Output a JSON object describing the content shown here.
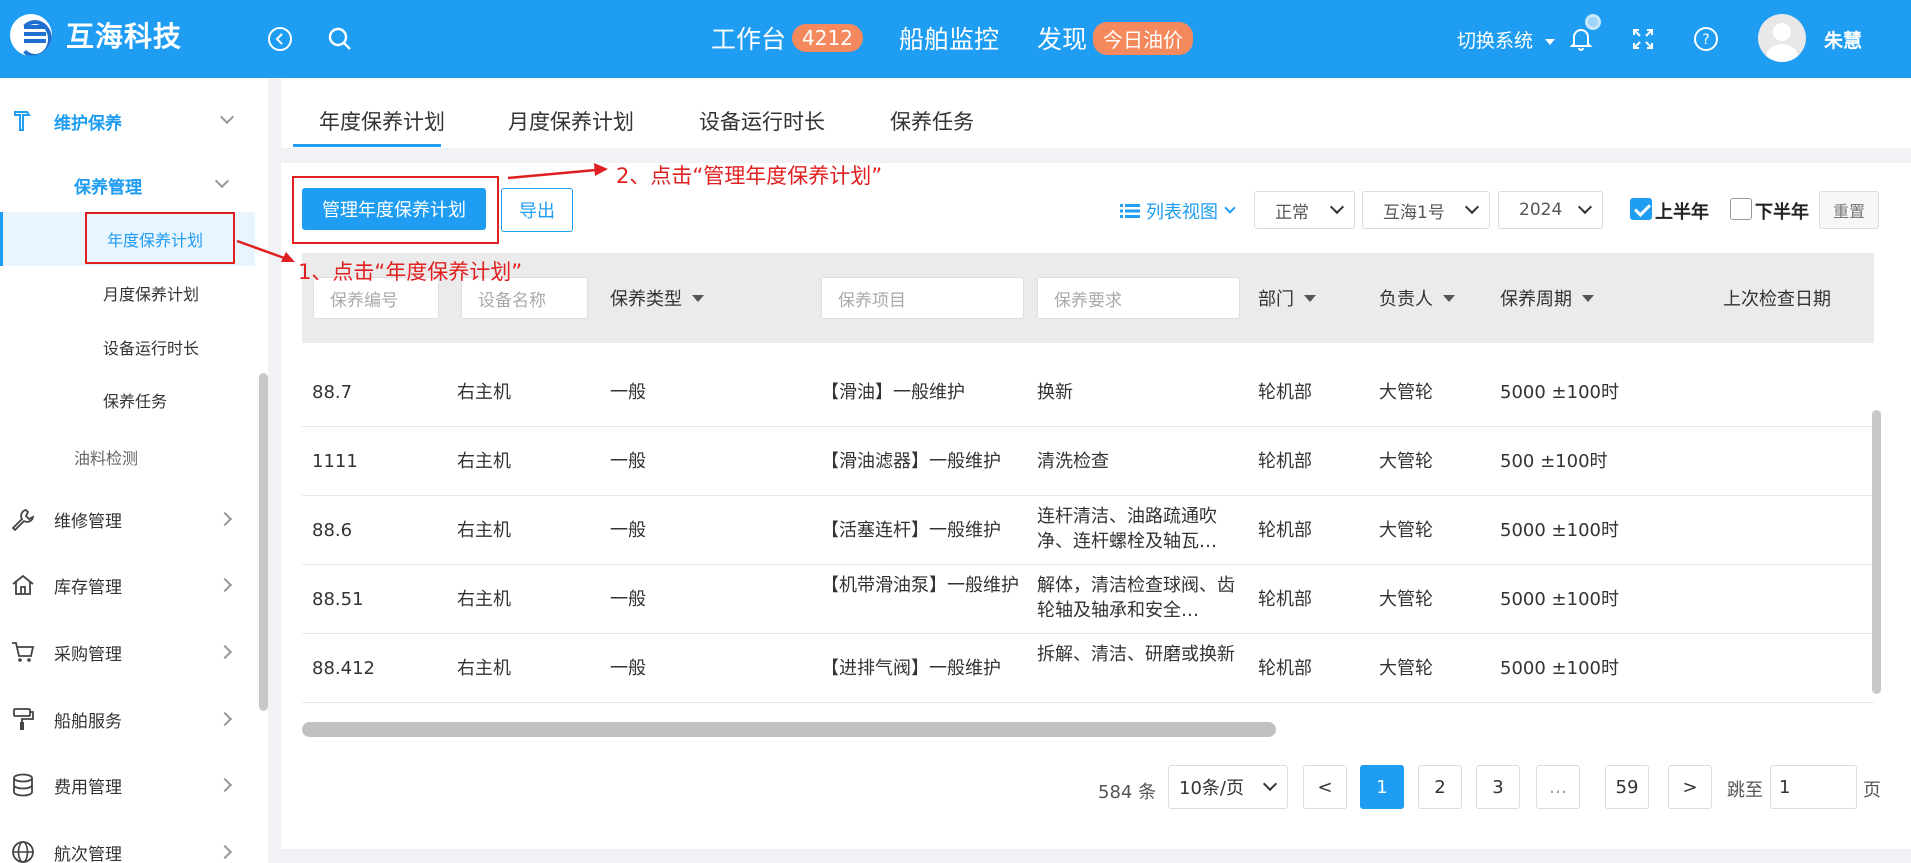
{
  "header": {
    "brand": "互海科技",
    "nav": [
      {
        "label": "工作台",
        "badge": "4212"
      },
      {
        "label": "船舶监控",
        "badge": ""
      },
      {
        "label": "发现",
        "badge": "今日油价"
      }
    ],
    "switch_system": "切换系统",
    "username": "朱慧"
  },
  "sidebar": {
    "maintenance": "维护保养",
    "maintenance_mgmt": "保养管理",
    "sub_items": [
      "年度保养计划",
      "月度保养计划",
      "设备运行时长",
      "保养任务"
    ],
    "oil_detection": "油料检测",
    "modules": [
      "维修管理",
      "库存管理",
      "采购管理",
      "船舶服务",
      "费用管理",
      "航次管理"
    ]
  },
  "tabs": [
    "年度保养计划",
    "月度保养计划",
    "设备运行时长",
    "保养任务"
  ],
  "toolbar": {
    "manage_btn": "管理年度保养计划",
    "export_btn": "导出",
    "view_toggle": "列表视图",
    "status_select": "正常",
    "ship_select": "互海1号",
    "year_select": "2024",
    "first_half": "上半年",
    "second_half": "下半年",
    "reset_btn": "重置"
  },
  "table": {
    "filters": {
      "code_placeholder": "保养编号",
      "device_placeholder": "设备名称",
      "type_label": "保养类型",
      "item_placeholder": "保养项目",
      "requirement_placeholder": "保养要求",
      "dept_label": "部门",
      "owner_label": "负责人",
      "cycle_label": "保养周期",
      "last_check_label": "上次检查日期"
    },
    "rows": [
      {
        "code": "88.7",
        "device": "右主机",
        "type": "一般",
        "item": "【滑油】一般维护",
        "req": "换新",
        "dept": "轮机部",
        "owner": "大管轮",
        "cycle": "5000 ±100时"
      },
      {
        "code": "1111",
        "device": "右主机",
        "type": "一般",
        "item": "【滑油滤器】一般维护",
        "req": "清洗检查",
        "dept": "轮机部",
        "owner": "大管轮",
        "cycle": "500 ±100时"
      },
      {
        "code": "88.6",
        "device": "右主机",
        "type": "一般",
        "item": "【活塞连杆】一般维护",
        "req": "连杆清洁、油路疏通吹净、连杆螺栓及轴瓦…",
        "dept": "轮机部",
        "owner": "大管轮",
        "cycle": "5000 ±100时"
      },
      {
        "code": "88.51",
        "device": "右主机",
        "type": "一般",
        "item": "【机带滑油泵】一般维护",
        "req": "解体，清洁检查球阀、齿轮轴及轴承和安全…",
        "dept": "轮机部",
        "owner": "大管轮",
        "cycle": "5000 ±100时"
      },
      {
        "code": "88.412",
        "device": "右主机",
        "type": "一般",
        "item": "【进排气阀】一般维护",
        "req": "拆解、清洁、研磨或换新",
        "dept": "轮机部",
        "owner": "大管轮",
        "cycle": "5000 ±100时"
      }
    ]
  },
  "pagination": {
    "total": "584 条",
    "page_size": "10条/页",
    "prev": "<",
    "pages": [
      "1",
      "2",
      "3",
      "…",
      "59"
    ],
    "next": ">",
    "jump_label": "跳至",
    "jump_value": "1",
    "page_suffix": "页"
  },
  "annotations": {
    "step1": "1、点击“年度保养计划”",
    "step2": "2、点击“管理年度保养计划”"
  }
}
